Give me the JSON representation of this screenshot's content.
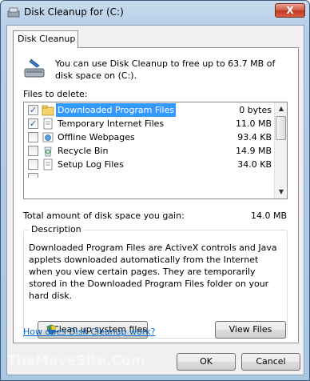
{
  "window": {
    "title": "Disk Cleanup for  (C:)",
    "close_label": "X"
  },
  "tab": {
    "label": "Disk Cleanup"
  },
  "intro": {
    "text": "You can use Disk Cleanup to free up to 63.7 MB of disk space on  (C:)."
  },
  "files": {
    "label": "Files to delete:",
    "items": [
      {
        "checked": "✓",
        "name": "Downloaded Program Files",
        "size": "0 bytes",
        "icon": "folder-icon"
      },
      {
        "checked": "✓",
        "name": "Temporary Internet Files",
        "size": "11.0 MB",
        "icon": "document-icon"
      },
      {
        "checked": "",
        "name": "Offline Webpages",
        "size": "93.4 KB",
        "icon": "webpage-icon"
      },
      {
        "checked": "",
        "name": "Recycle Bin",
        "size": "14.9 MB",
        "icon": "recycle-bin-icon"
      },
      {
        "checked": "",
        "name": "Setup Log Files",
        "size": "34.0 KB",
        "icon": "document-icon"
      }
    ]
  },
  "total": {
    "label": "Total amount of disk space you gain:",
    "value": "14.0 MB"
  },
  "description": {
    "title": "Description",
    "text": "Downloaded Program Files are ActiveX controls and Java applets downloaded automatically from the Internet when you view certain pages. They are temporarily stored in the Downloaded Program Files folder on your hard disk."
  },
  "buttons": {
    "clean_system": "Clean up system files",
    "view_files": "View Files",
    "ok": "OK",
    "cancel": "Cancel"
  },
  "help_link": "How does Disk Cleanup work?",
  "watermark": "TheMaveSite.Com"
}
